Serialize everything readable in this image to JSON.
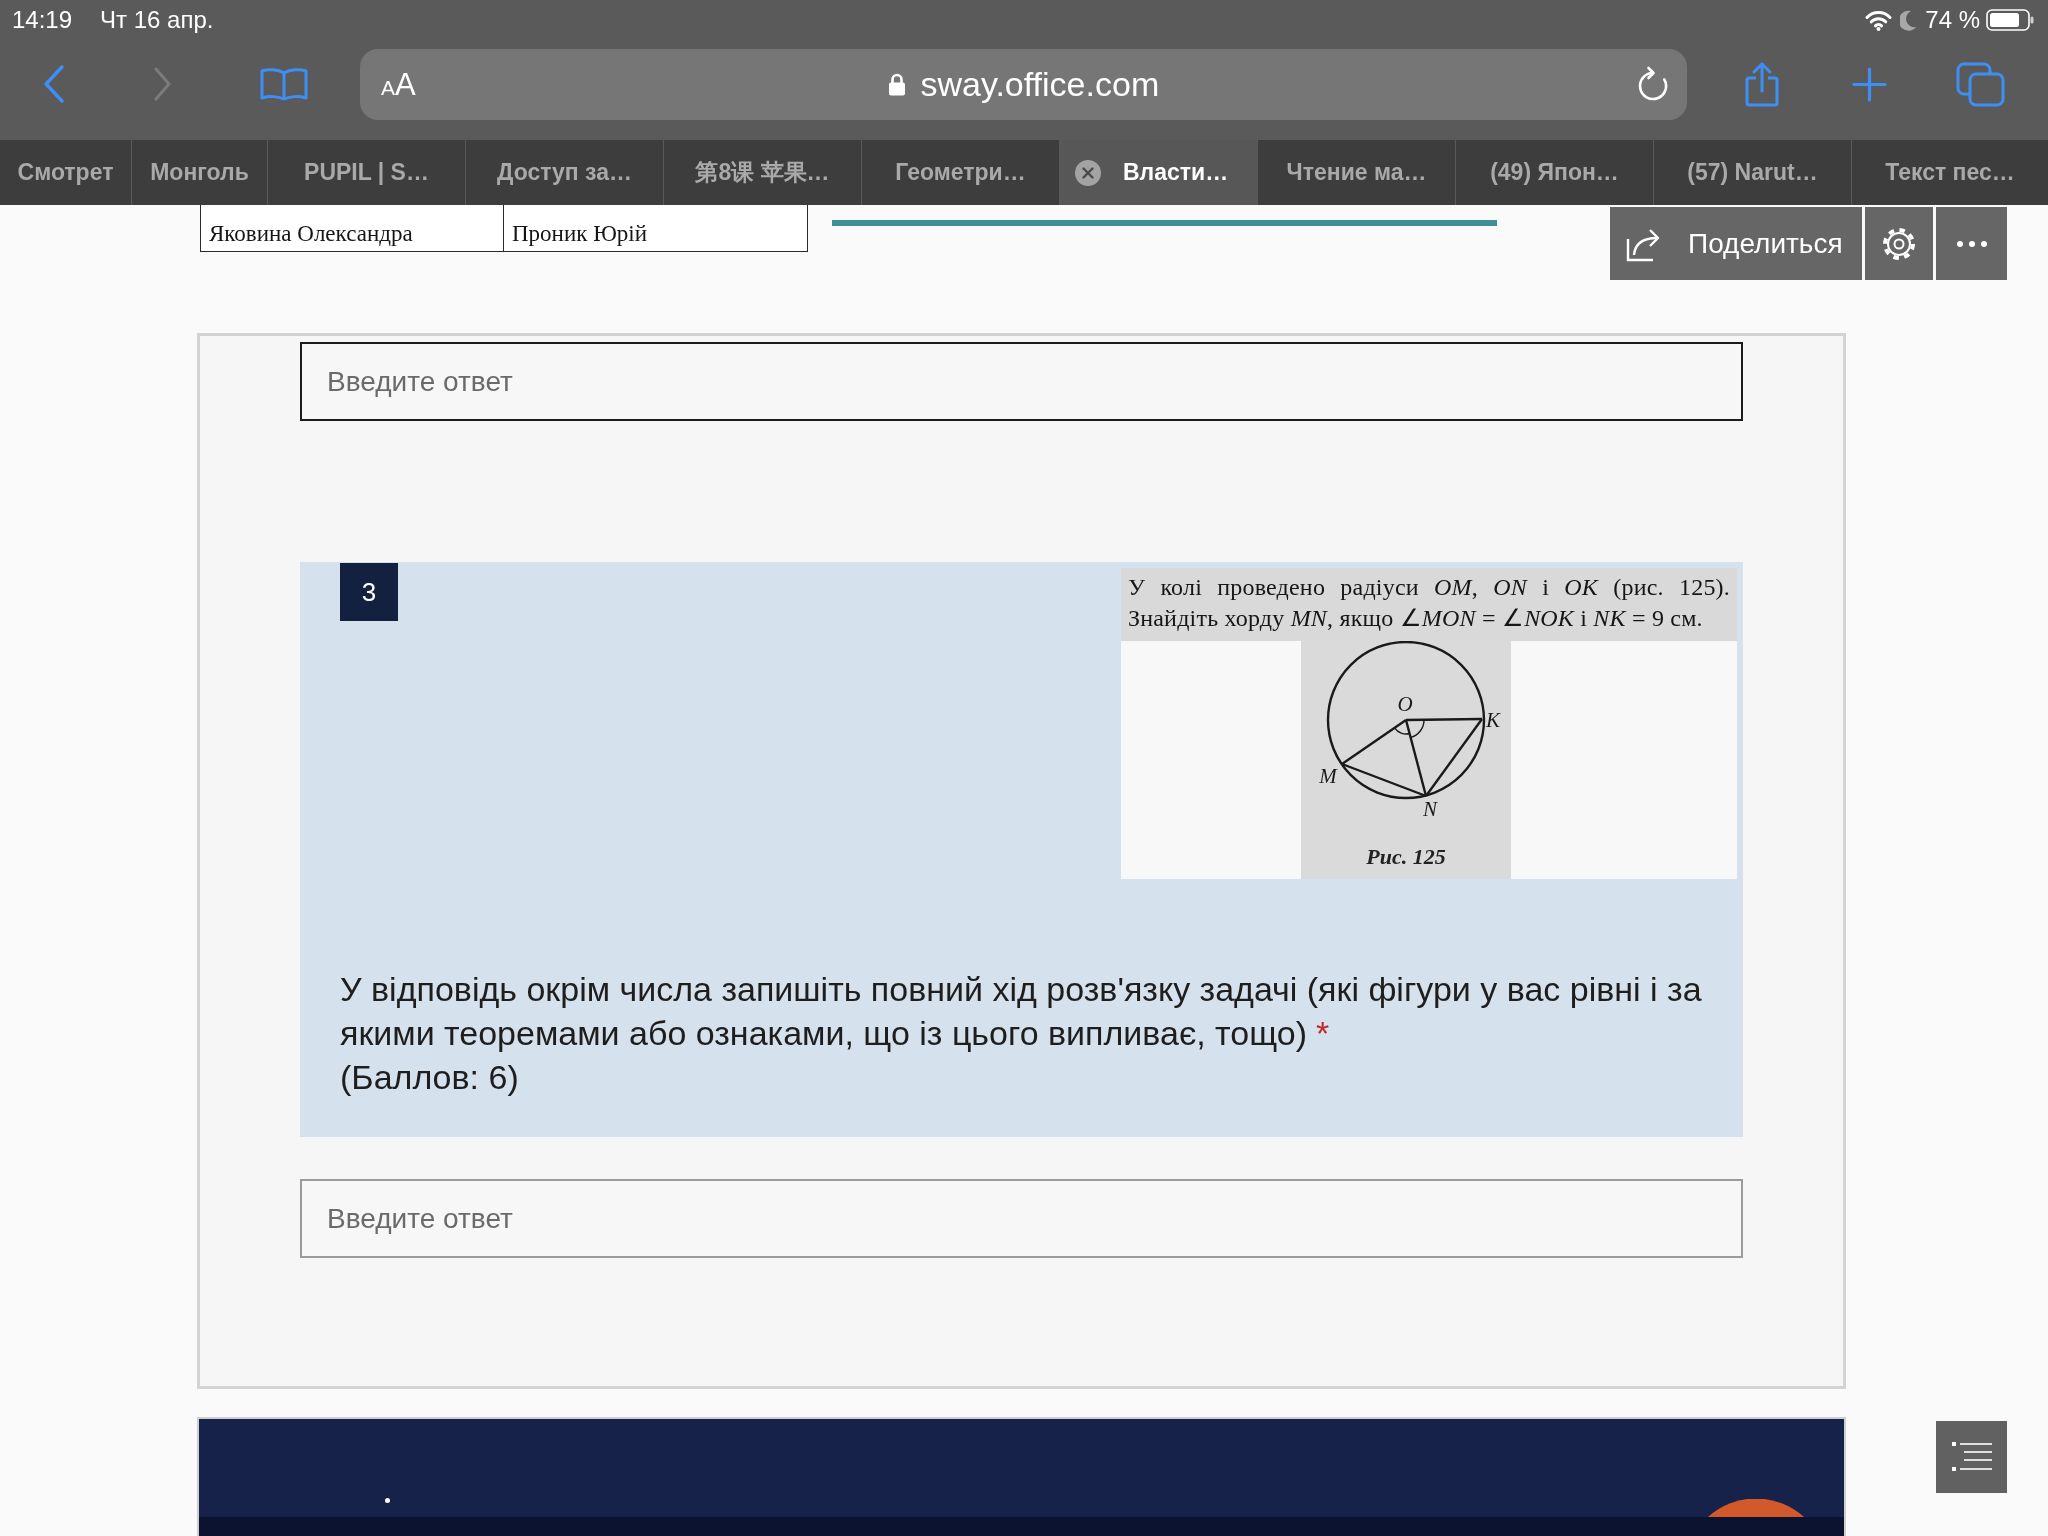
{
  "status_bar": {
    "time": "14:19",
    "date": "Чт 16 апр.",
    "battery": "74 %"
  },
  "toolbar": {
    "nav_buttons": [
      {
        "kind": "back",
        "disabled": false
      },
      {
        "kind": "forward",
        "disabled": true
      }
    ],
    "text_size_button": "AA",
    "url": "sway.office.com"
  },
  "tabs": [
    {
      "label": "Смотрет",
      "selected": false
    },
    {
      "label": "Монголь",
      "selected": false
    },
    {
      "label": "PUPIL | S…",
      "selected": false
    },
    {
      "label": "Доступ за…",
      "selected": false
    },
    {
      "label": "第8课 苹果…",
      "selected": false
    },
    {
      "label": "Геометри…",
      "selected": false
    },
    {
      "label": "Власти…",
      "selected": true
    },
    {
      "label": "Чтение ма…",
      "selected": false
    },
    {
      "label": "(49) Япон…",
      "selected": false
    },
    {
      "label": "(57) Narut…",
      "selected": false
    },
    {
      "label": "Текст пес…",
      "selected": false
    }
  ],
  "name_table": {
    "rows": [
      [
        "Яковина Олександра",
        "Проник Юрій"
      ]
    ]
  },
  "share_toolbar": {
    "share_label": "Поделиться"
  },
  "form": {
    "items": [
      {
        "kind": "answer",
        "placeholder": "Введите ответ",
        "focused": true
      },
      {
        "kind": "question",
        "number": "3",
        "excerpt": {
          "lines": [
            "У колі проведено радіуси *OM*, *ON* і *OK* (рис. 125).",
            "Знайдіть хорду *MN*, якщо ∠*MON* = ∠*NOK* і *NK* = 9 см."
          ],
          "point_labels": [
            "O",
            "K",
            "M",
            "N"
          ],
          "caption": "Рис. 125"
        },
        "text": "У відповідь окрім числа запишіть повний хід розв'язку задачі (які фігури у вас рівні і за якими теоремами або ознаками, що із цього випливає, тощо)",
        "required_mark": "*",
        "points": "(Баллов: 6)"
      },
      {
        "kind": "answer",
        "placeholder": "Введите ответ",
        "focused": false
      }
    ]
  }
}
